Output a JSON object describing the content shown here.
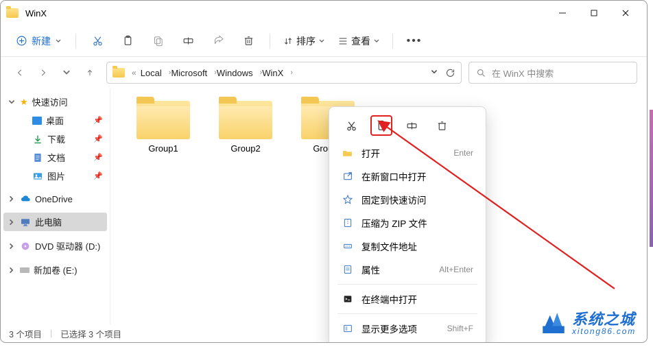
{
  "titlebar": {
    "title": "WinX"
  },
  "toolbar": {
    "new_label": "新建",
    "sort_label": "排序",
    "view_label": "查看"
  },
  "breadcrumb": {
    "overflow": "«",
    "items": [
      "Local",
      "Microsoft",
      "Windows",
      "WinX"
    ]
  },
  "search": {
    "placeholder": "在 WinX 中搜索"
  },
  "sidebar": {
    "quick_access": "快速访问",
    "desktop": "桌面",
    "downloads": "下载",
    "documents": "文档",
    "pictures": "图片",
    "onedrive": "OneDrive",
    "this_pc": "此电脑",
    "dvd": "DVD 驱动器 (D:)",
    "volume": "新加卷 (E:)"
  },
  "folders": [
    {
      "name": "Group1"
    },
    {
      "name": "Group2"
    },
    {
      "name": "Group3"
    }
  ],
  "context_menu": {
    "open": "打开",
    "open_shortcut": "Enter",
    "open_new_window": "在新窗口中打开",
    "pin_quick_access": "固定到快速访问",
    "compress_zip": "压缩为 ZIP 文件",
    "copy_path": "复制文件地址",
    "properties": "属性",
    "properties_shortcut": "Alt+Enter",
    "open_terminal": "在终端中打开",
    "show_more": "显示更多选项",
    "show_more_shortcut": "Shift+F"
  },
  "statusbar": {
    "items": "3 个项目",
    "selected": "已选择 3 个项目"
  },
  "watermark": {
    "cn": "系统之城",
    "en": "xitong86.com"
  }
}
